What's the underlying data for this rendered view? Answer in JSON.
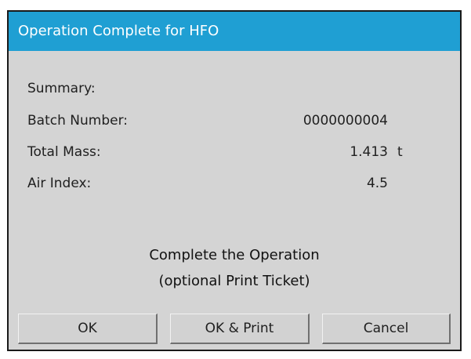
{
  "dialog": {
    "title": "Operation Complete for HFO",
    "summary_label": "Summary:",
    "rows": [
      {
        "label": "Batch Number:",
        "value": "0000000004",
        "unit": ""
      },
      {
        "label": "Total Mass:",
        "value": "1.413",
        "unit": "t"
      },
      {
        "label": "Air Index:",
        "value": "4.5",
        "unit": ""
      }
    ],
    "message_line1": "Complete the Operation",
    "message_line2": "(optional Print Ticket)",
    "buttons": {
      "ok": "OK",
      "ok_print": "OK & Print",
      "cancel": "Cancel"
    },
    "colors": {
      "titlebar": "#1f9fd3",
      "background": "#d4d4d4"
    }
  }
}
